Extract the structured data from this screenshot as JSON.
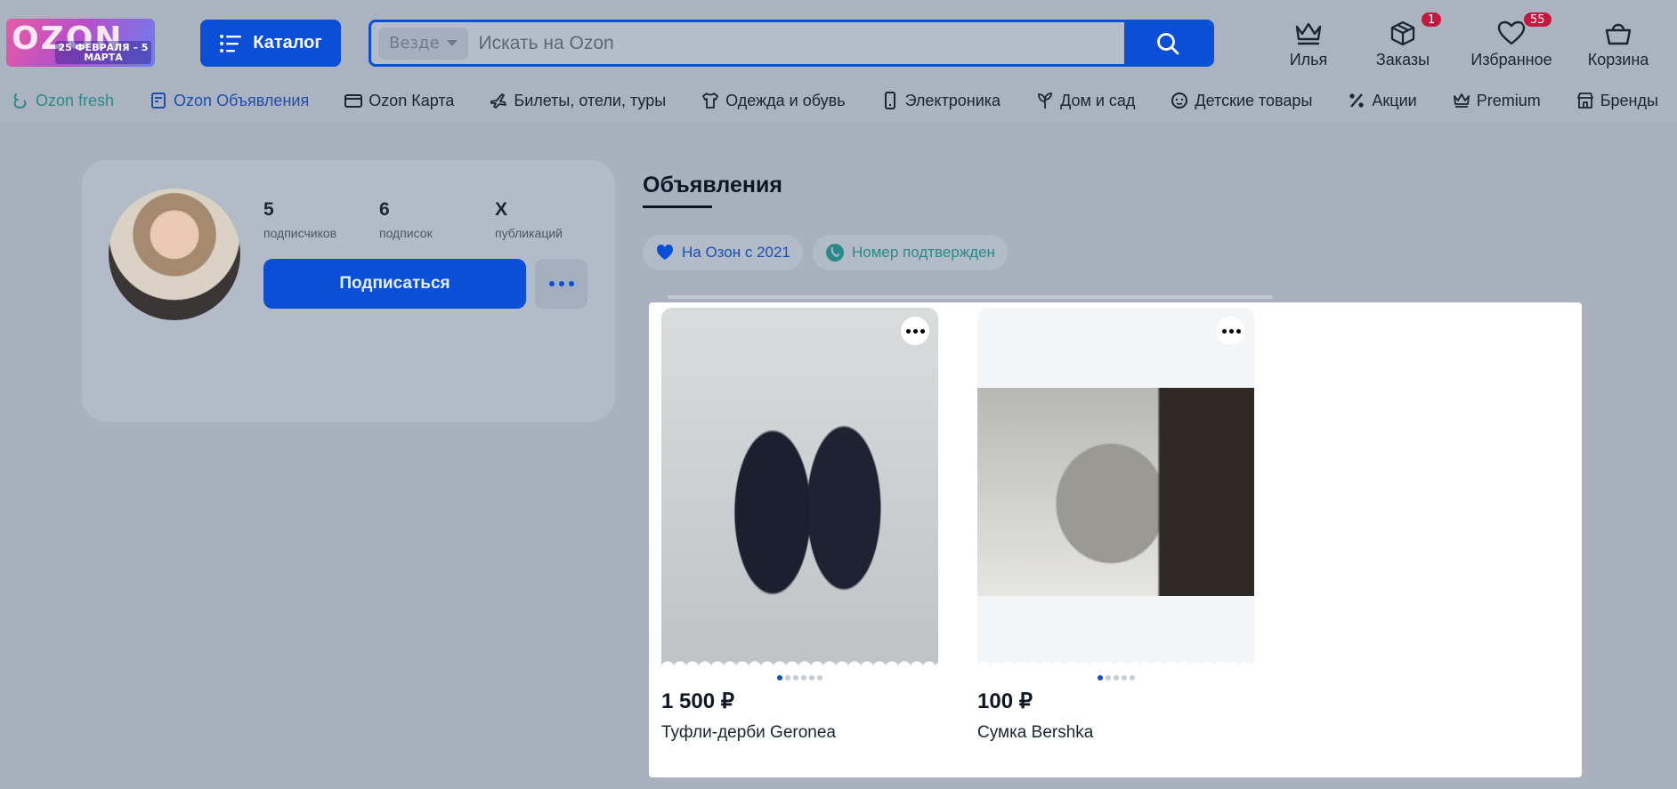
{
  "logo": {
    "brand": "OZON",
    "promo": "25 ФЕВРАЛЯ – 5 МАРТА"
  },
  "header": {
    "catalog_label": "Каталог",
    "search_scope": "Везде",
    "search_placeholder": "Искать на Ozon",
    "user_label": "Илья",
    "orders_label": "Заказы",
    "orders_badge": "1",
    "favorites_label": "Избранное",
    "favorites_badge": "55",
    "cart_label": "Корзина"
  },
  "nav": [
    {
      "label": "Ozon fresh",
      "icon": "fresh-icon"
    },
    {
      "label": "Ozon Объявления",
      "icon": "ads-icon"
    },
    {
      "label": "Ozon Карта",
      "icon": "card-icon"
    },
    {
      "label": "Билеты, отели, туры",
      "icon": "plane-icon"
    },
    {
      "label": "Одежда и обувь",
      "icon": "shirt-icon"
    },
    {
      "label": "Электроника",
      "icon": "phone-icon"
    },
    {
      "label": "Дом и сад",
      "icon": "plant-icon"
    },
    {
      "label": "Детские товары",
      "icon": "baby-icon"
    },
    {
      "label": "Акции",
      "icon": "percent-icon"
    },
    {
      "label": "Premium",
      "icon": "crown-icon"
    },
    {
      "label": "Бренды",
      "icon": "store-icon"
    }
  ],
  "profile": {
    "subscribers_count": "5",
    "subscribers_label": "подписчиков",
    "subscriptions_count": "6",
    "subscriptions_label": "подписок",
    "publications_count": "X",
    "publications_label": "публикаций",
    "subscribe_label": "Подписаться"
  },
  "listings": {
    "title": "Объявления",
    "chip_since": "На Озон с 2021",
    "chip_phone": "Номер подтвержден",
    "items": [
      {
        "price": "1 500 ₽",
        "name": "Туфли-дерби Geronea",
        "photos": 6,
        "active_photo": 1
      },
      {
        "price": "100 ₽",
        "name": "Сумка Bershka",
        "photos": 5,
        "active_photo": 1
      }
    ]
  },
  "colors": {
    "accent": "#0b4fd6",
    "badge": "#c4183f",
    "teal": "#2a8a8a",
    "background": "#abb3c0"
  }
}
